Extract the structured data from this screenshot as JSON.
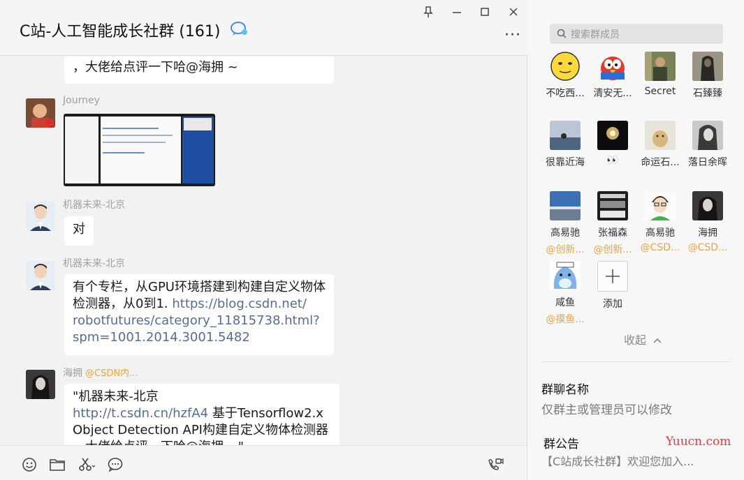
{
  "window": {
    "title": "C站-人工智能成长社群 (161)",
    "controls": {
      "pin": "pin-icon",
      "minimize": "minimize-icon",
      "maximize": "maximize-icon",
      "close": "close-icon"
    }
  },
  "messages": [
    {
      "id": "m0",
      "bubble_text": "，大佬给点评一下哈@海拥 ~"
    },
    {
      "id": "m1",
      "sender": "Journey",
      "kind": "image"
    },
    {
      "id": "m2",
      "sender": "机器未来-北京",
      "bubble_text": "对"
    },
    {
      "id": "m3",
      "sender": "机器未来-北京",
      "text_line1": "有个专栏，从GPU环境搭建到构建自定义物体",
      "text_line2": "检测器，从0到1. ",
      "link_part1": "https://blog.csdn.net/",
      "link_part2": "robotfutures/category_11815738.html?",
      "link_part3": "spm=1001.2014.3001.5482"
    },
    {
      "id": "m4",
      "sender": "海拥",
      "sender_tag": "@CSDN内...",
      "line1": "\"机器未来-北京",
      "link": "http://t.csdn.cn/hzfA4",
      "line2_rest": " 基于Tensorflow2.x",
      "line3": "Object Detection API构建自定义物体检测器",
      "line4": "，大佬给点评一下哈@海拥 ~\""
    }
  ],
  "toolbar": {
    "icons": [
      "emoji-icon",
      "folder-icon",
      "scissors-icon",
      "chat-bubble-icon",
      "video-call-icon"
    ]
  },
  "panel": {
    "search_placeholder": "搜索群成员",
    "members": [
      {
        "name": "不吃西...",
        "tag": ""
      },
      {
        "name": "清安无...",
        "tag": ""
      },
      {
        "name": "Secret",
        "tag": ""
      },
      {
        "name": "石臻臻",
        "tag": ""
      },
      {
        "name": "很靠近海",
        "tag": ""
      },
      {
        "name": "👀",
        "tag": ""
      },
      {
        "name": "命运石...",
        "tag": ""
      },
      {
        "name": "落日余晖",
        "tag": ""
      },
      {
        "name": "高易驰",
        "tag": "@创新..."
      },
      {
        "name": "张福森",
        "tag": "@创新..."
      },
      {
        "name": "高易驰",
        "tag": "@CSD..."
      },
      {
        "name": "海拥",
        "tag": "@CSD..."
      },
      {
        "name": "咸鱼",
        "tag": "@摸鱼..."
      }
    ],
    "add_label": "添加",
    "collapse_label": "收起",
    "group_name_title": "群聊名称",
    "group_name_hint": "仅群主或管理员可以修改",
    "notice_title": "群公告",
    "notice_preview": "【C站成长社群】欢迎您加入..."
  },
  "watermark": "Yuucn.com",
  "colors": {
    "link": "#576b95",
    "tag_orange": "#f0a33c",
    "bubble": "#ffffff",
    "background": "#f2f2f2"
  }
}
